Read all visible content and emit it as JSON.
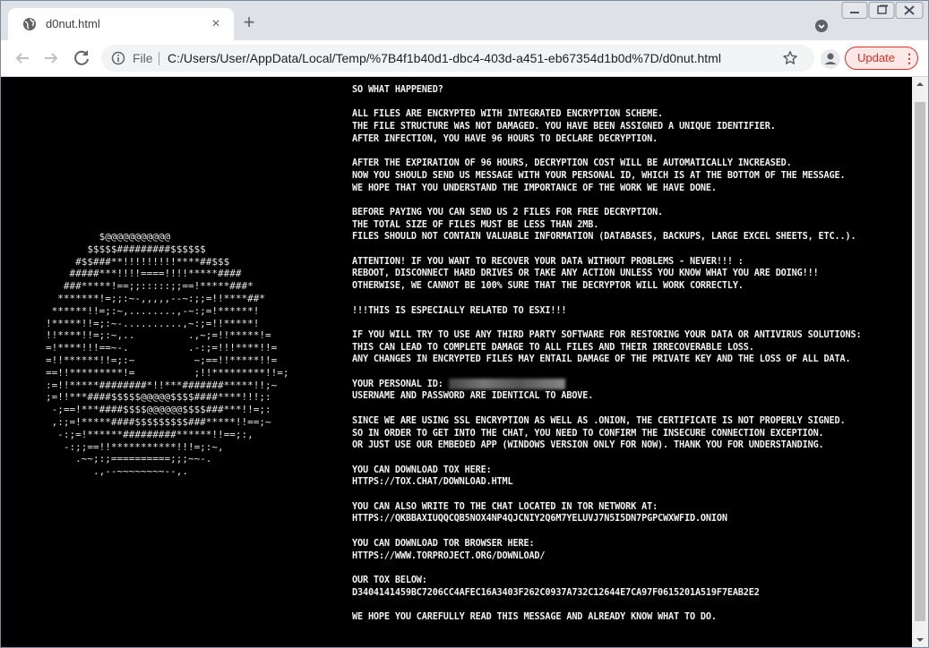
{
  "tab": {
    "title": "d0nut.html",
    "close_icon": "×",
    "new_tab_icon": "+"
  },
  "toolbar": {
    "file_label": "File",
    "url": "C:/Users/User/AppData/Local/Temp/%7B4f1b40d1-dbc4-403d-a451-eb67354d1b0d%7D/d0nut.html",
    "update_label": "Update",
    "update_menu_icon": "⋮"
  },
  "colors": {
    "update_accent": "#d93025",
    "page_background": "#000000",
    "page_text": "#f2f2f2"
  },
  "ascii_art": "         $@@@@@@@@@@@\n       $$$$$#########$$$$$$\n     #$$###**!!!!!!!!!****##$$$\n    #####***!!!!====!!!!*****####\n   ###*****!==;;:::::;;==!*****###*\n  *******!=;;:~-,,,,,--~:;;=!!****##*\n ******!!=;:~,........,-~:;=!******!\n!*****!!=;:~-..........,~:;=!!*****!\n!!****!!=;:~,..         .,~;=!!*****!=\n=!****!!!==~-.          .-:;=!!!****!!=\n=!!******!!=;:~          ~;==!!*****!!=\n==!!*********!=          ;!!*********!!=;\n:=!!*****########*!!***#######*****!!;~\n;=!!***####$$$$$@@@@@$$$$####****!!!;:\n -;==!***####$$$$@@@@@@$$$$###***!!=;:\n ,:;=!*****####$$$$$$$$$###*****!!==;~\n  -:;=!******#########******!!==;:,\n   -:;;==!!***********!!!=;:~,\n     .~~;:;==========;;;~~-.\n        .,--~~~~~~~~--,.",
  "note": [
    "SO WHAT HAPPENED?",
    "",
    "ALL FILES ARE ENCRYPTED WITH INTEGRATED ENCRYPTION SCHEME.",
    "THE FILE STRUCTURE WAS NOT DAMAGED. YOU HAVE BEEN ASSIGNED A UNIQUE IDENTIFIER.",
    "AFTER INFECTION, YOU HAVE 96 HOURS TO DECLARE DECRYPTION.",
    "",
    "AFTER THE EXPIRATION OF 96 HOURS, DECRYPTION COST WILL BE AUTOMATICALLY INCREASED.",
    "NOW YOU SHOULD SEND US MESSAGE WITH YOUR PERSONAL ID, WHICH IS AT THE BOTTOM OF THE MESSAGE.",
    "WE HOPE THAT YOU UNDERSTAND THE IMPORTANCE OF THE WORK WE HAVE DONE.",
    "",
    "BEFORE PAYING YOU CAN SEND US 2 FILES FOR FREE DECRYPTION.",
    "THE TOTAL SIZE OF FILES MUST BE LESS THAN 2MB.",
    "FILES SHOULD NOT CONTAIN VALUABLE INFORMATION (DATABASES, BACKUPS, LARGE EXCEL SHEETS, ETC..).",
    "",
    "ATTENTION! IF YOU WANT TO RECOVER YOUR DATA WITHOUT PROBLEMS - NEVER!!! :",
    "REBOOT, DISCONNECT HARD DRIVES OR TAKE ANY ACTION UNLESS YOU KNOW WHAT YOU ARE DOING!!!",
    "OTHERWISE, WE CANNOT BE 100% SURE THAT THE DECRYPTOR WILL WORK CORRECTLY.",
    "",
    "!!!THIS IS ESPECIALLY RELATED TO ESXI!!!",
    "",
    "IF YOU WILL TRY TO USE ANY THIRD PARTY SOFTWARE FOR RESTORING YOUR DATA OR ANTIVIRUS SOLUTIONS:",
    "THIS CAN LEAD TO COMPLETE DAMAGE TO ALL FILES AND THEIR IRRECOVERABLE LOSS.",
    "ANY CHANGES IN ENCRYPTED FILES MAY ENTAIL DAMAGE OF THE PRIVATE KEY AND THE LOSS OF ALL DATA.",
    "",
    "YOUR PERSONAL ID:",
    "USERNAME AND PASSWORD ARE IDENTICAL TO ABOVE.",
    "",
    "SINCE WE ARE USING SSL ENCRYPTION AS WELL AS .ONION, THE CERTIFICATE IS NOT PROPERLY SIGNED.",
    "SO IN ORDER TO GET INTO THE CHAT, YOU NEED TO CONFIRM THE INSECURE CONNECTION EXCEPTION.",
    "OR JUST USE OUR EMBEDED APP (WINDOWS VERSION ONLY FOR NOW). THANK YOU FOR UNDERSTANDING.",
    "",
    "YOU CAN DOWNLOAD TOX HERE:",
    "HTTPS://TOX.CHAT/DOWNLOAD.HTML",
    "",
    "YOU CAN ALSO WRITE TO THE CHAT LOCATED IN TOR NETWORK AT:",
    "HTTPS://QKBBAXIUQQCQB5NOX4NP4QJCNIY2Q6M7YELUVJ7N5I5DN7PGPCWXWFID.ONION",
    "",
    "YOU CAN DOWNLOAD TOR BROWSER HERE:",
    "HTTPS://WWW.TORPROJECT.ORG/DOWNLOAD/",
    "",
    "OUR TOX BELOW:",
    "D3404141459BC7206CC4AFEC16A3403F262C0937A732C12644E7CA97F0615201A519F7EAB2E2",
    "",
    "WE HOPE YOU CAREFULLY READ THIS MESSAGE AND ALREADY KNOW WHAT TO DO."
  ]
}
